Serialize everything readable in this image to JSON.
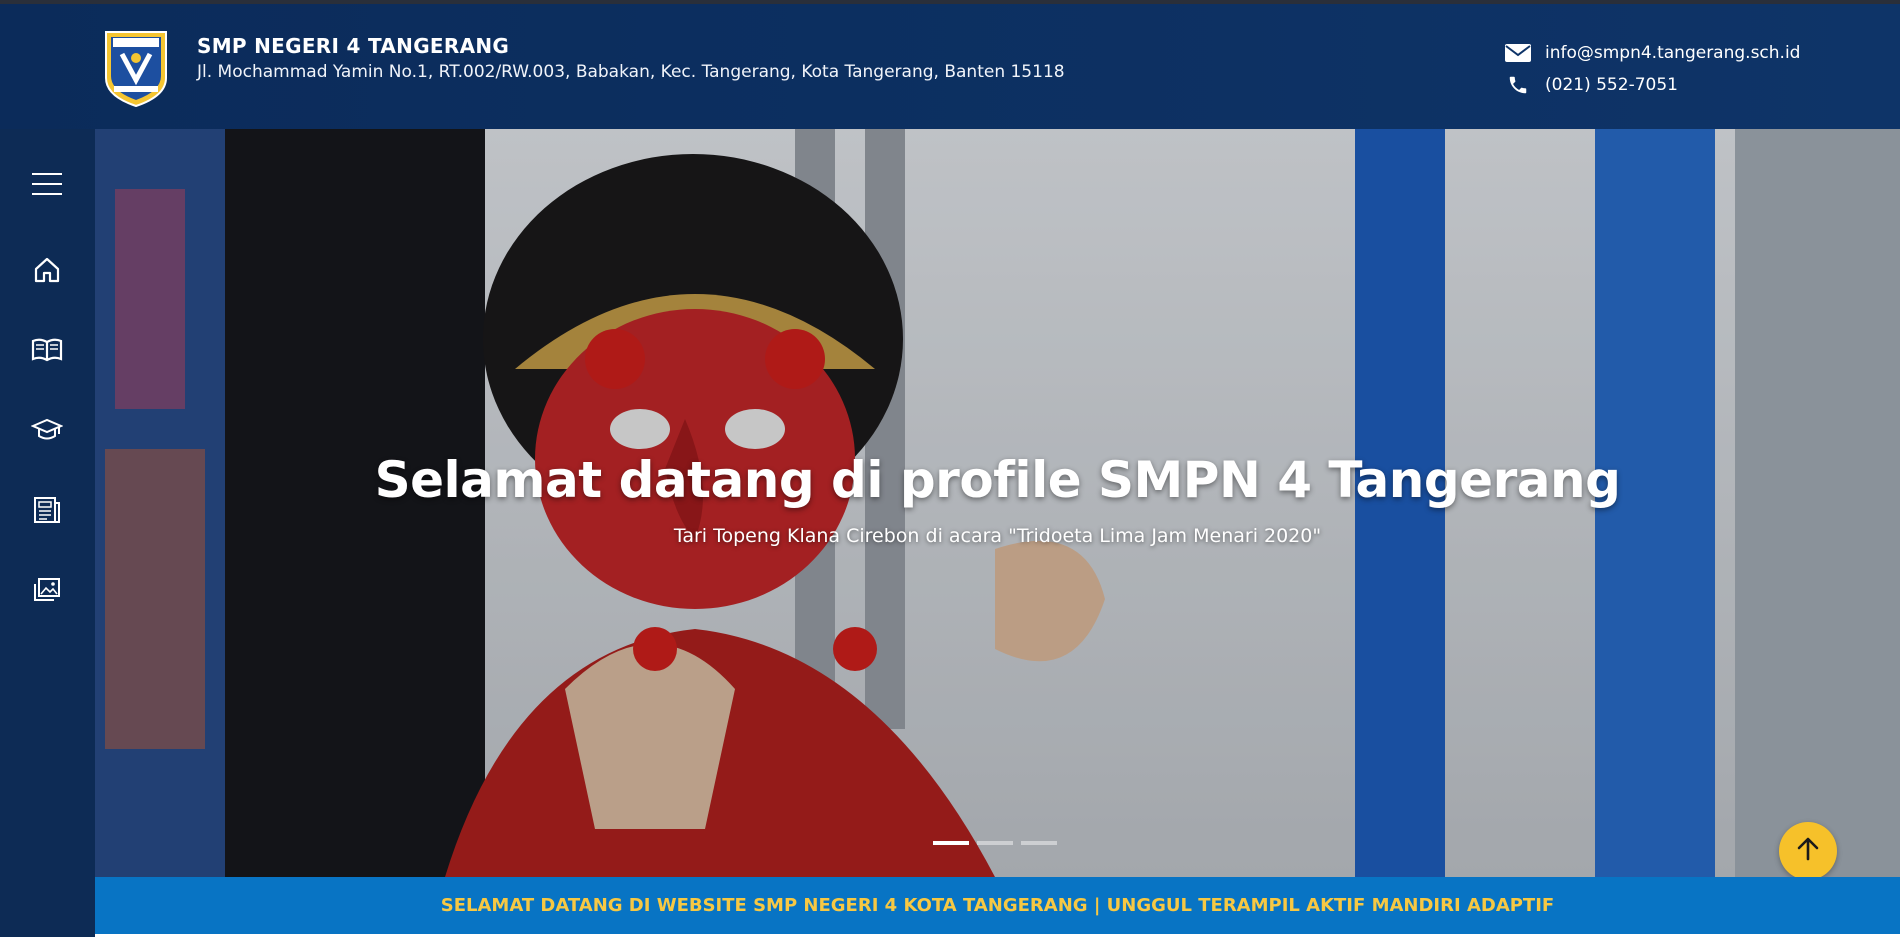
{
  "header": {
    "school_name": "SMP NEGERI 4 TANGERANG",
    "address": "Jl. Mochammad Yamin No.1, RT.002/RW.003, Babakan, Kec. Tangerang, Kota Tangerang, Banten 15118",
    "email": "info@smpn4.tangerang.sch.id",
    "phone": "(021) 552-7051",
    "logo_icon": "school-crest-icon"
  },
  "sidebar": {
    "items": [
      {
        "name": "menu",
        "icon": "hamburger-menu-icon"
      },
      {
        "name": "home",
        "icon": "home-icon"
      },
      {
        "name": "profile",
        "icon": "open-book-icon"
      },
      {
        "name": "academics",
        "icon": "graduation-cap-icon"
      },
      {
        "name": "news",
        "icon": "newspaper-icon"
      },
      {
        "name": "gallery",
        "icon": "image-gallery-icon"
      }
    ]
  },
  "hero": {
    "title": "Selamat datang di profile SMPN 4 Tangerang",
    "caption": "Tari Topeng Klana Cirebon di acara \"Tridoeta Lima Jam Menari 2020\"",
    "slide_count": 3,
    "active_slide": 1
  },
  "ticker": {
    "text": "SELAMAT DATANG DI WEBSITE SMP NEGERI 4 KOTA TANGERANG | UNGGUL TERAMPIL AKTIF MANDIRI ADAPTIF"
  },
  "colors": {
    "header_bg": "#0b2b5a",
    "sidebar_bg": "#0d2b55",
    "ticker_bg": "#0874c4",
    "ticker_text": "#f7c843",
    "scroll_top_button": "#f6c12a"
  },
  "scroll_top": {
    "icon": "arrow-up-icon"
  }
}
